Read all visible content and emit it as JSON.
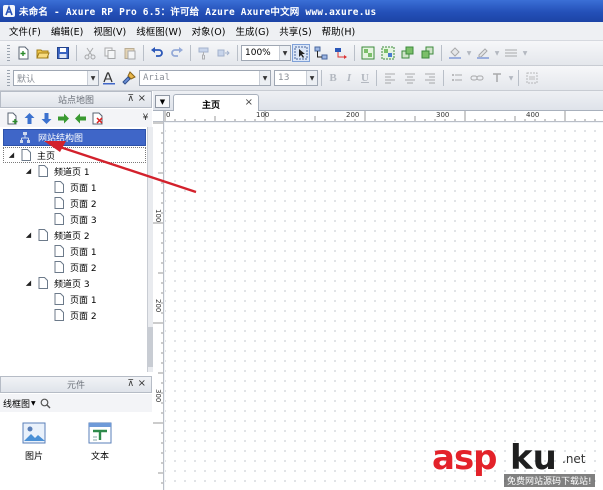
{
  "window": {
    "title": "未命名 - Axure RP Pro 6.5：许可给 Azure Axure中文网 www.axure.us"
  },
  "menubar": [
    {
      "label": "文件(F)"
    },
    {
      "label": "编辑(E)"
    },
    {
      "label": "视图(V)"
    },
    {
      "label": "线框图(W)"
    },
    {
      "label": "对象(O)"
    },
    {
      "label": "生成(G)"
    },
    {
      "label": "共享(S)"
    },
    {
      "label": "帮助(H)"
    }
  ],
  "toolbar": {
    "zoom_value": "100%"
  },
  "format_toolbar": {
    "style_value": "默认",
    "font_value": "Arial",
    "size_value": "13"
  },
  "sitemap": {
    "title": "站点地图",
    "root": "网站结构图",
    "home": "主页",
    "sections": [
      {
        "label": "频道页 1",
        "pages": [
          "页面 1",
          "页面 2",
          "页面 3"
        ]
      },
      {
        "label": "频道页 2",
        "pages": [
          "页面 1",
          "页面 2"
        ]
      },
      {
        "label": "频道页 3",
        "pages": [
          "页面 1",
          "页面 2"
        ]
      }
    ]
  },
  "widgets": {
    "title": "元件",
    "library": "线框图",
    "items": [
      {
        "label": "图片",
        "icon": "image-icon"
      },
      {
        "label": "文本",
        "icon": "text-icon"
      }
    ]
  },
  "editor": {
    "tab_label": "主页",
    "ruler_h": [
      "0",
      "100",
      "200",
      "300",
      "400"
    ],
    "ruler_v": [
      "100",
      "200",
      "300"
    ]
  },
  "colors": {
    "selection": "#3f66c8",
    "annotation_arrow": "#d3212c",
    "watermark_red": "#e3222a"
  },
  "watermark": {
    "brand_a": "asp",
    "brand_b": "ku",
    "suffix": ".net",
    "subtitle": "免费网站源码下载站!"
  }
}
